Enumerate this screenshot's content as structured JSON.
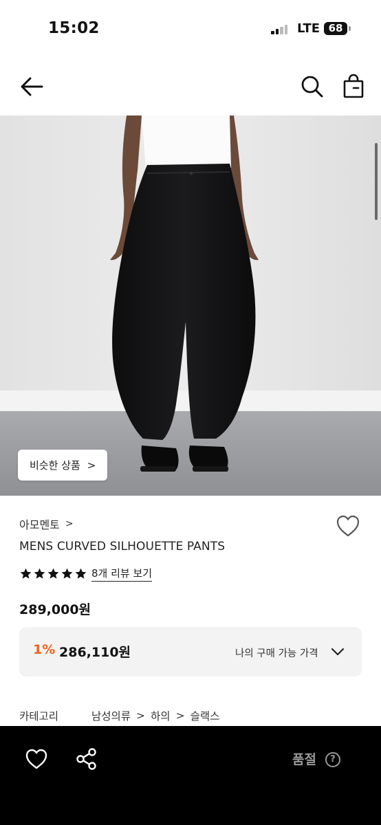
{
  "status_bar": {
    "time": "15:02",
    "network": "LTE",
    "battery": "68"
  },
  "header": {
    "icons": [
      "back-arrow-icon",
      "search-icon",
      "shopping-bag-icon"
    ]
  },
  "product_image": {
    "similar_button_label": "비슷한 상품",
    "similar_button_chevron": ">"
  },
  "product": {
    "brand": "아모멘토",
    "brand_chevron": ">",
    "name": "MENS CURVED SILHOUETTE PANTS",
    "rating_stars": 5,
    "review_link": "8개 리뷰 보기",
    "price": "289,000원"
  },
  "my_price": {
    "rate": "1%",
    "value": "286,110원",
    "label": "나의 구매 가능 가격"
  },
  "category": {
    "label": "카테고리",
    "path": [
      "남성의류",
      "하의",
      "슬랙스"
    ],
    "separator": ">"
  },
  "bottom_bar": {
    "status": "품절",
    "help_symbol": "?"
  },
  "colors": {
    "accent": "#f0641e",
    "bottom_bar_bg": "#000000",
    "price_box_bg": "#f3f3f4"
  }
}
